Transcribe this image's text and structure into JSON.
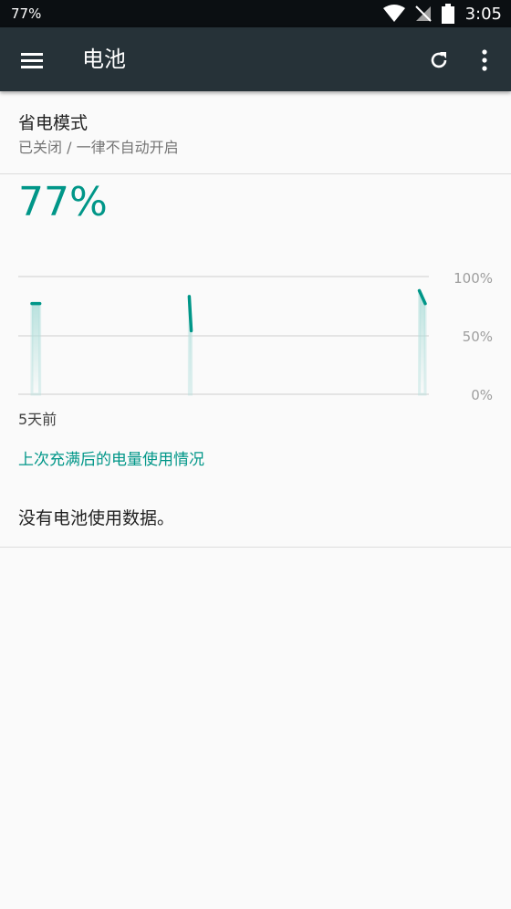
{
  "status_bar": {
    "battery_text": "77%",
    "time": "3:05"
  },
  "app_bar": {
    "title": "电池"
  },
  "battery_saver": {
    "title": "省电模式",
    "summary": "已关闭 / 一律不自动开启"
  },
  "battery_percent": "77%",
  "chart_data": {
    "type": "line",
    "y_tick_labels": [
      "100%",
      "50%",
      "0%"
    ],
    "ylim": [
      0,
      100
    ],
    "x_label_start": "5天前",
    "series": [
      {
        "segment": 1,
        "points": [
          [
            0.0,
            77
          ],
          [
            0.02,
            77
          ]
        ]
      },
      {
        "segment": 2,
        "points": [
          [
            0.4,
            83
          ],
          [
            0.405,
            54
          ]
        ]
      },
      {
        "segment": 3,
        "points": [
          [
            0.985,
            88
          ],
          [
            1.0,
            77
          ]
        ]
      }
    ],
    "colors": {
      "line": "#009688",
      "grid": "#dddddd",
      "fill": "#b2dfdb"
    }
  },
  "history_link": "上次充满后的电量使用情况",
  "no_data_text": "没有电池使用数据。"
}
